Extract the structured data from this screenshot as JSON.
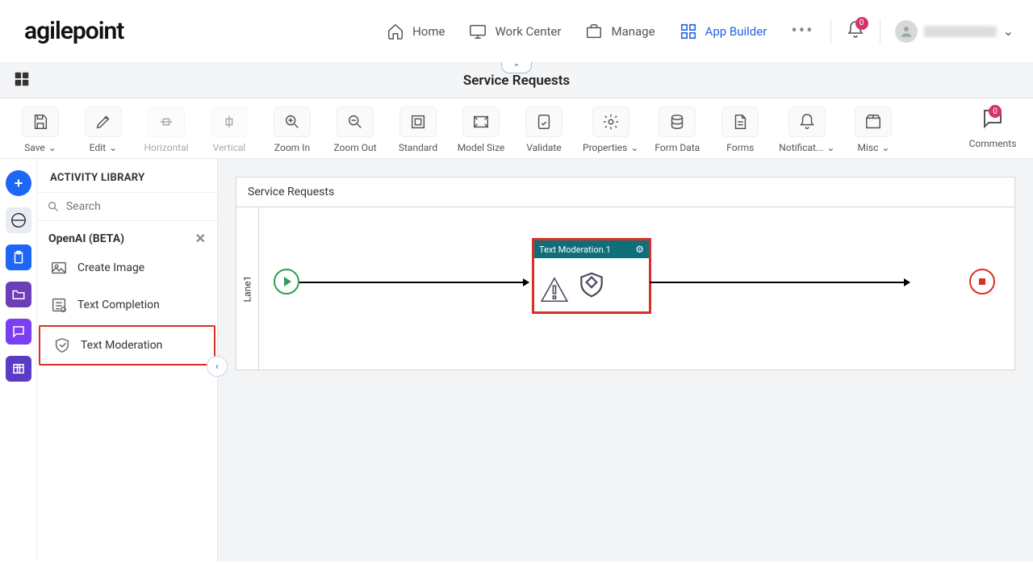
{
  "logo": "agilepoint",
  "nav": {
    "home": "Home",
    "work_center": "Work Center",
    "manage": "Manage",
    "app_builder": "App Builder"
  },
  "notif_count": "0",
  "subbar": {
    "title": "Service Requests"
  },
  "toolbar": {
    "save": "Save",
    "edit": "Edit",
    "horizontal": "Horizontal",
    "vertical": "Vertical",
    "zoom_in": "Zoom In",
    "zoom_out": "Zoom Out",
    "standard": "Standard",
    "model_size": "Model Size",
    "validate": "Validate",
    "properties": "Properties",
    "form_data": "Form Data",
    "forms": "Forms",
    "notifications": "Notificat...",
    "misc": "Misc",
    "comments": "Comments",
    "comments_count": "0"
  },
  "library": {
    "title": "ACTIVITY LIBRARY",
    "search_ph": "Search",
    "section": "OpenAI (BETA)",
    "items": {
      "create_image": "Create Image",
      "text_completion": "Text Completion",
      "text_moderation": "Text Moderation"
    }
  },
  "canvas": {
    "title": "Service Requests",
    "lane": "Lane1",
    "task_label": "Text Moderation.1"
  }
}
